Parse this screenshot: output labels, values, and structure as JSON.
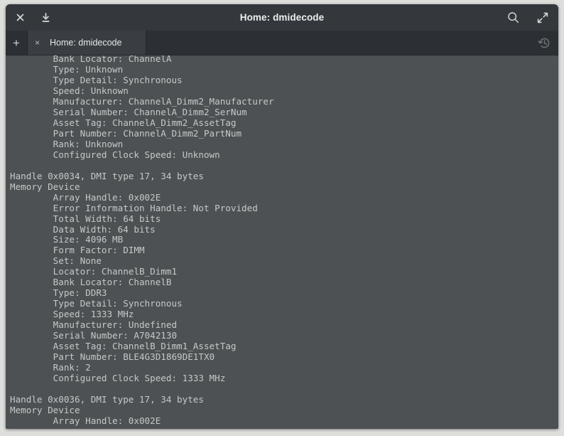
{
  "window": {
    "title": "Home: dmidecode",
    "titlebar_buttons_left": [
      {
        "name": "close-icon",
        "label": "×"
      },
      {
        "name": "minimize-download-icon",
        "label": "⤓"
      }
    ],
    "titlebar_buttons_right": [
      {
        "name": "search-icon",
        "label": "⌕"
      },
      {
        "name": "fullscreen-icon",
        "label": "⤡"
      }
    ]
  },
  "tabbar": {
    "new_tab_label": "+",
    "tabs": [
      {
        "close_label": "×",
        "label": "Home: dmidecode"
      }
    ],
    "history_icon": "history-icon"
  },
  "terminal": {
    "background": "#4d5153",
    "foreground": "#c5c9c8",
    "lines": [
      "        Bank Locator: ChannelA",
      "        Type: Unknown",
      "        Type Detail: Synchronous",
      "        Speed: Unknown",
      "        Manufacturer: ChannelA_Dimm2_Manufacturer",
      "        Serial Number: ChannelA_Dimm2_SerNum",
      "        Asset Tag: ChannelA_Dimm2_AssetTag",
      "        Part Number: ChannelA_Dimm2_PartNum",
      "        Rank: Unknown",
      "        Configured Clock Speed: Unknown",
      "",
      "Handle 0x0034, DMI type 17, 34 bytes",
      "Memory Device",
      "        Array Handle: 0x002E",
      "        Error Information Handle: Not Provided",
      "        Total Width: 64 bits",
      "        Data Width: 64 bits",
      "        Size: 4096 MB",
      "        Form Factor: DIMM",
      "        Set: None",
      "        Locator: ChannelB_Dimm1",
      "        Bank Locator: ChannelB",
      "        Type: DDR3",
      "        Type Detail: Synchronous",
      "        Speed: 1333 MHz",
      "        Manufacturer: Undefined",
      "        Serial Number: A7042130",
      "        Asset Tag: ChannelB_Dimm1_AssetTag",
      "        Part Number: BLE4G3D1869DE1TX0",
      "        Rank: 2",
      "        Configured Clock Speed: 1333 MHz",
      "",
      "Handle 0x0036, DMI type 17, 34 bytes",
      "Memory Device",
      "        Array Handle: 0x002E"
    ]
  }
}
